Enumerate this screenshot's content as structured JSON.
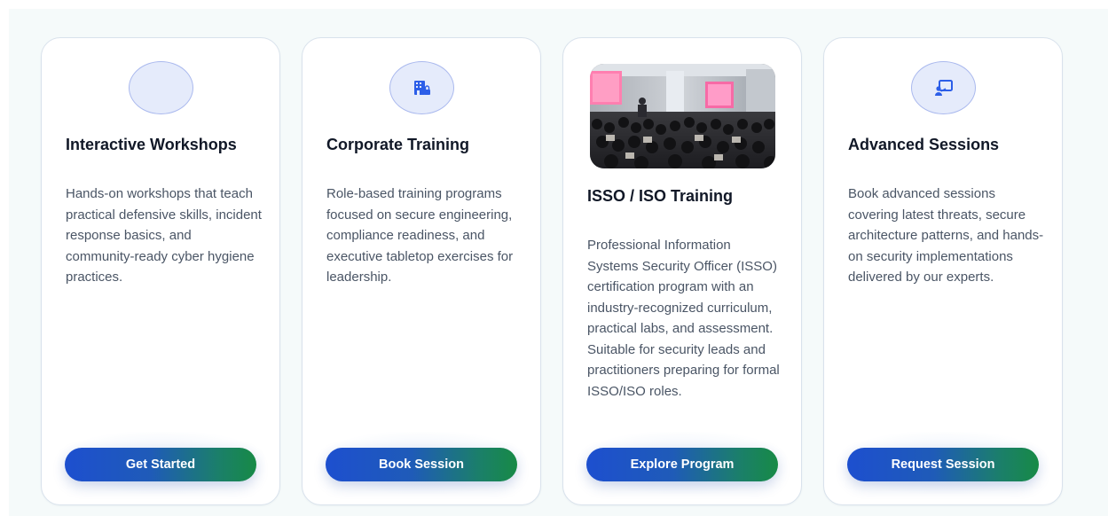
{
  "cards": [
    {
      "title": "Interactive Workshops",
      "description": "Hands-on workshops that teach practical defensive skills, incident response basics, and community-ready cyber hygiene practices.",
      "button_label": "Get Started",
      "icon": "blank-icon"
    },
    {
      "title": "Corporate Training",
      "description": "Role-based training programs focused on secure engineering, compliance readiness, and executive tabletop exercises for leadership.",
      "button_label": "Book Session",
      "icon": "building-lock-icon"
    },
    {
      "title": "ISSO / ISO Training",
      "description": "Professional Information Systems Security Officer (ISSO) certification program with an industry-recognized curriculum, practical labs, and assessment. Suitable for security leads and practitioners preparing for formal ISSO/ISO roles.",
      "button_label": "Explore Program",
      "image": "training-audience-photo"
    },
    {
      "title": "Advanced Sessions",
      "description": "Book advanced sessions covering latest threats, secure architecture patterns, and hands-on security implementations delivered by our experts.",
      "button_label": "Request Session",
      "icon": "presenter-screen-icon"
    }
  ],
  "colors": {
    "accent_blue": "#1d4fcf",
    "accent_green": "#178a46",
    "icon_circle_fill": "#e5ebfb",
    "icon_blue": "#2c5ee8"
  }
}
